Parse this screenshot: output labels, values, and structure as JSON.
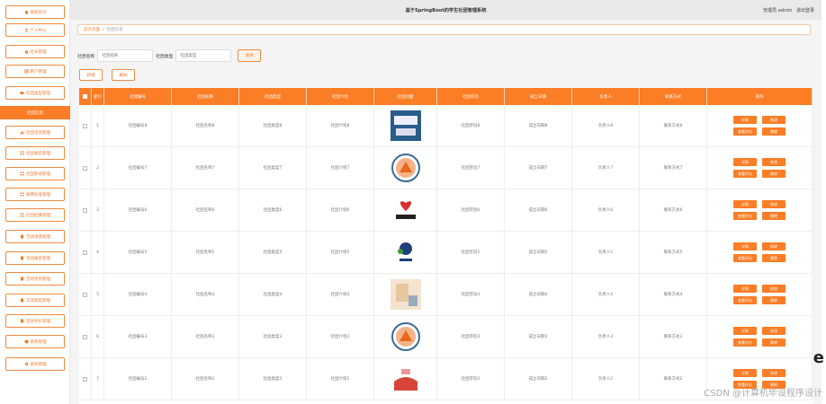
{
  "header": {
    "title": "基于SpringBoot的学生社团管理系统",
    "user_label": "管理员 admin",
    "logout": "退出登录"
  },
  "sidebar": {
    "items": [
      {
        "label": "系统首页",
        "icon": "home-icon"
      },
      {
        "label": "个人中心",
        "icon": "user-icon"
      },
      {
        "label": "社长管理",
        "icon": "lock-icon"
      },
      {
        "label": "用户管理",
        "icon": "users-icon"
      },
      {
        "label": "社团类型管理",
        "icon": "folder-icon"
      },
      {
        "label": "社团信息",
        "icon": "",
        "active": true
      },
      {
        "label": "社团活动管理",
        "icon": "bar-icon"
      },
      {
        "label": "社团报名管理",
        "icon": "grid-icon"
      },
      {
        "label": "社团新闻管理",
        "icon": "grid-icon"
      },
      {
        "label": "收费标准管理",
        "icon": "grid-icon"
      },
      {
        "label": "社团招募管理",
        "icon": "grid-icon"
      },
      {
        "label": "活动详情管理",
        "icon": "doc-icon"
      },
      {
        "label": "活动报名管理",
        "icon": "doc-icon"
      },
      {
        "label": "活动签到管理",
        "icon": "doc-icon"
      },
      {
        "label": "交流类型管理",
        "icon": "doc-icon"
      },
      {
        "label": "活动评价管理",
        "icon": "doc-icon"
      },
      {
        "label": "系统管理",
        "icon": "shield-icon"
      },
      {
        "label": "系统管理",
        "icon": "gear-icon"
      }
    ]
  },
  "breadcrumb": {
    "home": "首页页面",
    "sep": "/",
    "current": "社团信息"
  },
  "search": {
    "name_label": "社团名称",
    "name_placeholder": "社团名称",
    "type_label": "社团类型",
    "type_placeholder": "社团类型",
    "button": "查询"
  },
  "actions": {
    "add": "新增",
    "delete": "删除"
  },
  "table": {
    "headers": [
      "",
      "索引",
      "社团编号",
      "社团名称",
      "社团类型",
      "社团介绍",
      "社团封面",
      "社团宗旨",
      "成立日期",
      "负责人",
      "联系方式",
      "操作"
    ],
    "rows": [
      {
        "idx": "1",
        "no": "社团编号8",
        "name": "社团名称8",
        "type": "社团类型8",
        "intro": "社团介绍8",
        "aim": "社团宗旨8",
        "date": "成立日期8",
        "leader": "负责人8",
        "contact": "联系方式8"
      },
      {
        "idx": "2",
        "no": "社团编号7",
        "name": "社团名称7",
        "type": "社团类型7",
        "intro": "社团介绍7",
        "aim": "社团宗旨7",
        "date": "成立日期7",
        "leader": "负责人7",
        "contact": "联系方式7"
      },
      {
        "idx": "3",
        "no": "社团编号6",
        "name": "社团名称6",
        "type": "社团类型6",
        "intro": "社团介绍6",
        "aim": "社团宗旨6",
        "date": "成立日期6",
        "leader": "负责人6",
        "contact": "联系方式6"
      },
      {
        "idx": "4",
        "no": "社团编号5",
        "name": "社团名称5",
        "type": "社团类型5",
        "intro": "社团介绍5",
        "aim": "社团宗旨5",
        "date": "成立日期5",
        "leader": "负责人5",
        "contact": "联系方式5"
      },
      {
        "idx": "5",
        "no": "社团编号4",
        "name": "社团名称4",
        "type": "社团类型4",
        "intro": "社团介绍4",
        "aim": "社团宗旨4",
        "date": "成立日期4",
        "leader": "负责人4",
        "contact": "联系方式4"
      },
      {
        "idx": "6",
        "no": "社团编号3",
        "name": "社团名称3",
        "type": "社团类型3",
        "intro": "社团介绍3",
        "aim": "社团宗旨3",
        "date": "成立日期3",
        "leader": "负责人3",
        "contact": "联系方式3"
      },
      {
        "idx": "7",
        "no": "社团编号2",
        "name": "社团名称2",
        "type": "社团类型2",
        "intro": "社团介绍2",
        "aim": "社团宗旨2",
        "date": "成立日期2",
        "leader": "负责人2",
        "contact": "联系方式2"
      }
    ],
    "op_labels": {
      "detail": "详情",
      "edit": "修改",
      "comment": "查看评论",
      "delete": "删除"
    }
  },
  "colors": {
    "accent": "#fb7d25",
    "header_bg": "#e9e9e9"
  },
  "watermark": "CSDN @计算机毕设程序设计"
}
